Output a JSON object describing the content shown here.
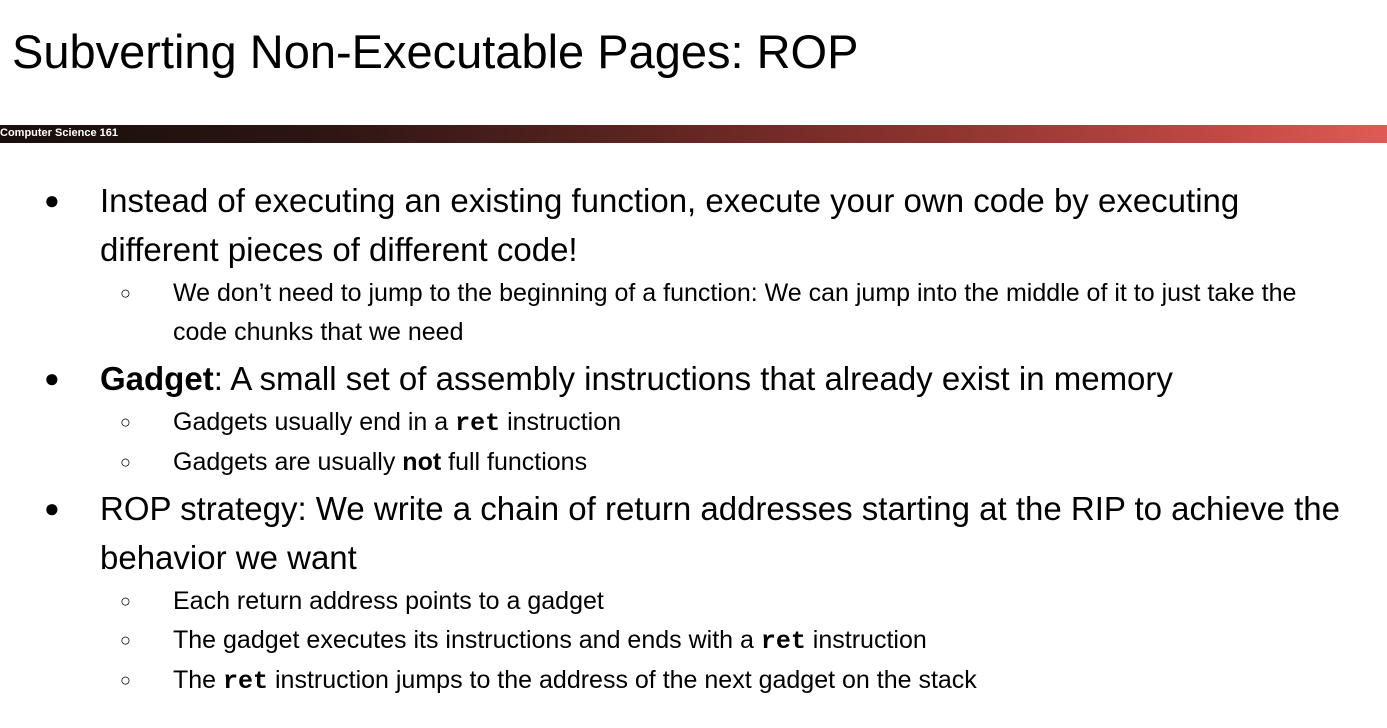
{
  "slide": {
    "title": "Subverting Non-Executable Pages: ROP",
    "banner_label": "Computer Science 161"
  },
  "bullets": [
    {
      "marker": "●",
      "text": "Instead of executing an existing function, execute your own code by executing different pieces of different code!",
      "subs": [
        {
          "marker": "○",
          "text": "We don’t need to jump to the beginning of a function: We can jump into the middle of it to just take the code chunks that we need"
        }
      ]
    },
    {
      "marker": "●",
      "bold_lead": "Gadget",
      "text": ": A small set of assembly instructions that already exist in memory",
      "subs": [
        {
          "marker": "○",
          "pre": "Gadgets usually end in a ",
          "code": "ret",
          "post": " instruction"
        },
        {
          "marker": "○",
          "pre": "Gadgets are usually ",
          "bold": "not",
          "post": " full functions"
        }
      ]
    },
    {
      "marker": "●",
      "text": "ROP strategy: We write a chain of return addresses starting at the RIP to achieve the behavior we want",
      "subs": [
        {
          "marker": "○",
          "text": "Each return address points to a gadget"
        },
        {
          "marker": "○",
          "pre": "The gadget executes its instructions and ends with a ",
          "code": "ret",
          "post": " instruction"
        },
        {
          "marker": "○",
          "pre": "The ",
          "code": "ret",
          "post": " instruction jumps to the address of the next gadget on the stack"
        }
      ]
    }
  ]
}
